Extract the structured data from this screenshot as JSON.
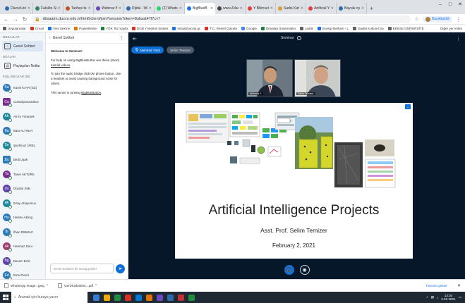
{
  "browser": {
    "tabs": [
      {
        "label": "DüzceÜniversi",
        "color": "#2b6cb0",
        "active": false
      },
      {
        "label": "Fakülte Sis",
        "color": "#2f855a",
        "active": false
      },
      {
        "label": "Tarihçe bul",
        "color": "#c05621",
        "active": false
      },
      {
        "label": "Webinar Bul",
        "color": "#6b46c1",
        "active": false
      },
      {
        "label": "Dijital - WhTS",
        "color": "#2b6cb0",
        "active": false
      },
      {
        "label": "(2) WhatsApp",
        "color": "#25d366",
        "active": false
      },
      {
        "label": "BigBlueB",
        "color": "#1a73e8",
        "active": true
      },
      {
        "label": "www.Zdasi.Comunit",
        "color": "#444444",
        "active": false
      },
      {
        "label": "Y Bilimsel",
        "color": "#e53e3e",
        "active": false
      },
      {
        "label": "Sadık Kahraman",
        "color": "#d69e2e",
        "active": false
      },
      {
        "label": "Artificial YTM",
        "color": "#e53e3e",
        "active": false
      },
      {
        "label": "Bayrak oyunu",
        "color": "#2b6cb0",
        "active": false
      }
    ],
    "new_tab": "+",
    "window_controls": [
      "–",
      "□",
      "✕"
    ],
    "nav": {
      "back": "←",
      "forward": "→",
      "reload": "↻"
    },
    "address": "dbsaatm.duzce.edu.tr/html5client/join?sessionToken=8ubaat47f7cv7",
    "profile_label": "Duraklatıldı",
    "bookmarks": [
      {
        "label": "Uygulamalar",
        "color": "#5f6368"
      },
      {
        "label": "Gmail",
        "color": "#d93025"
      },
      {
        "label": "Yeni Sekme",
        "color": "#1a73e8"
      },
      {
        "label": "PowerBeste",
        "color": "#e37400"
      },
      {
        "label": "YÖK Tez Sayfa",
        "color": "#188038"
      },
      {
        "label": "DGB Yönetimi Sistem",
        "color": "#d93025"
      },
      {
        "label": "Intrast/yocsis.gc",
        "color": "#1a73e8"
      },
      {
        "label": "T.C. Resmî Gazete",
        "color": "#d93025"
      },
      {
        "label": "Google",
        "color": "#4285f4"
      },
      {
        "label": "Dimakta Üniversitesi",
        "color": "#188038"
      },
      {
        "label": "Lastik",
        "color": "#5f6368"
      },
      {
        "label": "Energi Merkezi - L",
        "color": "#1a73e8"
      },
      {
        "label": "Dadisi Kulturel Sp",
        "color": "#5f6368"
      },
      {
        "label": "EEKSE ÜNİVERSİTE",
        "color": "#5f6368"
      }
    ],
    "bookmarks_right": "Diğer yer imleri"
  },
  "app": {
    "messages_label": "MESAJLAR",
    "public_chat_label": "Genel Sohbet",
    "notes_label": "NOTLAR",
    "shared_notes_label": "Paylaşılan Notlar",
    "users_header": "KULLANICILAR (25)",
    "users": [
      {
        "initials": "Ka",
        "name": "Kamil KAYA (Siz)",
        "color": "#2c7ab8",
        "square": false
      },
      {
        "initials": "Ca",
        "name": "Cuhadyarusoubus",
        "color": "#7a2f8f",
        "square": true
      },
      {
        "initials": "Ah",
        "name": "Ali Ihı Yürümek",
        "color": "#1f8a9e",
        "square": false
      },
      {
        "initials": "Ba",
        "name": "Batu ALTINAY",
        "color": "#2c7ab8",
        "square": false
      },
      {
        "initials": "Se",
        "name": "Şeyhmuz ÜREL",
        "color": "#1f8a9e",
        "square": false
      },
      {
        "initials": "Bu",
        "name": "Bedi Uşak",
        "color": "#2c7ab8",
        "square": true
      },
      {
        "initials": "Ta",
        "name": "Taner AKTÜRK",
        "color": "#7a2f8f",
        "square": false
      },
      {
        "initials": "Ds",
        "name": "Dündar Sitki",
        "color": "#5d3fa8",
        "square": false
      },
      {
        "initials": "Ak",
        "name": "Ertay Abayemus",
        "color": "#1f8a9e",
        "square": false
      },
      {
        "initials": "Ha",
        "name": "Halime Aldıng",
        "color": "#2c7ab8",
        "square": false
      },
      {
        "initials": "Ib",
        "name": "İlhan DİNMAZ",
        "color": "#2c7ab8",
        "square": false
      },
      {
        "initials": "Ak",
        "name": "Hanmaz Duru",
        "color": "#9e3b6f",
        "square": false
      },
      {
        "initials": "Bg",
        "name": "Busem Emir",
        "color": "#5d3fa8",
        "square": false
      },
      {
        "initials": "Ed",
        "name": "Emel Deniz",
        "color": "#2c7ab8",
        "square": false
      }
    ],
    "chat": {
      "back": "‹",
      "title": "Genel Sohbet",
      "more": "⋮",
      "welcome": "Welcome to Seminar!",
      "line1": "For help on using BigBlueButton see these (short)",
      "line1_link": "tutorial videos",
      "line2": "To join the audio bridge click the phone button. Use a headset to avoid causing background noise for others.",
      "line3": "This server is running",
      "line3_link": "BigBlueButton",
      "placeholder": "Genel Sohbet'e bir mesaj gönder",
      "send": "➤"
    },
    "main": {
      "recording": "Seminar",
      "pill_talk": "Mehmet Yüzü",
      "pill_listen": "Selim Temizer",
      "cam1_name": "Mehmet Y.",
      "cam2_name": "Selim Temizer",
      "slide_title": "Artificial Intelligence Projects",
      "slide_author": "Asst. Prof. Selim Temizer",
      "slide_date": "February 2, 2021"
    }
  },
  "downloads": {
    "items": [
      {
        "name": "WhatsApp Image...jpeg"
      },
      {
        "name": "Gerizlusbriktirn...pdf"
      }
    ],
    "show_all": "Tümünü göster",
    "close": "✕"
  },
  "taskbar": {
    "search_placeholder": "Aramak için buraya yazın",
    "clock_time": "13:02",
    "clock_date": "2.02.2021",
    "apps": [
      "#3a7bd5",
      "#f2a900",
      "#1e8e3e",
      "#d93025",
      "#0078d4",
      "#e37400",
      "#6b46c1",
      "#2b6cb0",
      "#c53030",
      "#1e8e3e"
    ]
  }
}
